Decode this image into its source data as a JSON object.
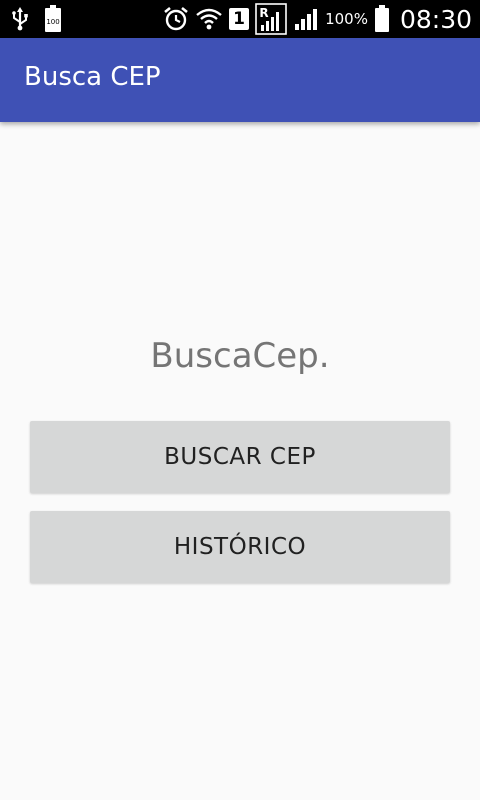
{
  "status_bar": {
    "icons": [
      "usb-icon",
      "battery-saver-icon",
      "alarm-icon",
      "wifi-icon",
      "sim-icon",
      "roaming-signal-icon",
      "signal-icon",
      "battery-icon"
    ],
    "sim_number": "1",
    "battery_saver_level": "100",
    "battery_percent": "100%",
    "time": "08:30"
  },
  "app_bar": {
    "title": "Busca CEP",
    "color": "#3f51b5"
  },
  "main": {
    "heading": "BuscaCep.",
    "buttons": {
      "buscar_cep": "BUSCAR CEP",
      "historico": "HISTÓRICO"
    }
  }
}
